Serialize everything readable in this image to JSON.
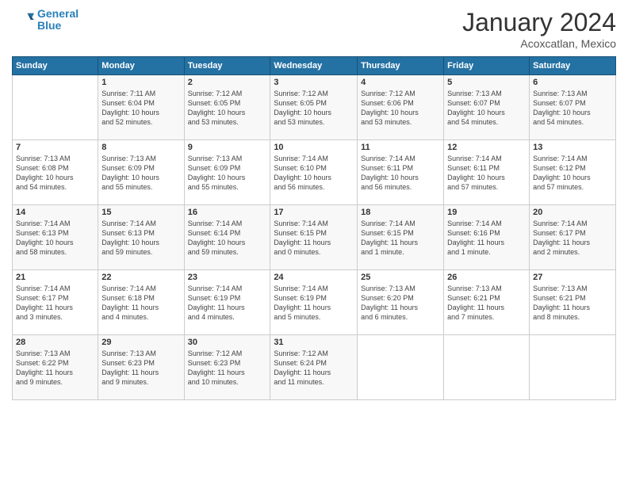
{
  "logo": {
    "line1": "General",
    "line2": "Blue"
  },
  "title": "January 2024",
  "location": "Acoxcatlan, Mexico",
  "days_header": [
    "Sunday",
    "Monday",
    "Tuesday",
    "Wednesday",
    "Thursday",
    "Friday",
    "Saturday"
  ],
  "weeks": [
    [
      {
        "day": "",
        "info": ""
      },
      {
        "day": "1",
        "info": "Sunrise: 7:11 AM\nSunset: 6:04 PM\nDaylight: 10 hours\nand 52 minutes."
      },
      {
        "day": "2",
        "info": "Sunrise: 7:12 AM\nSunset: 6:05 PM\nDaylight: 10 hours\nand 53 minutes."
      },
      {
        "day": "3",
        "info": "Sunrise: 7:12 AM\nSunset: 6:05 PM\nDaylight: 10 hours\nand 53 minutes."
      },
      {
        "day": "4",
        "info": "Sunrise: 7:12 AM\nSunset: 6:06 PM\nDaylight: 10 hours\nand 53 minutes."
      },
      {
        "day": "5",
        "info": "Sunrise: 7:13 AM\nSunset: 6:07 PM\nDaylight: 10 hours\nand 54 minutes."
      },
      {
        "day": "6",
        "info": "Sunrise: 7:13 AM\nSunset: 6:07 PM\nDaylight: 10 hours\nand 54 minutes."
      }
    ],
    [
      {
        "day": "7",
        "info": "Sunrise: 7:13 AM\nSunset: 6:08 PM\nDaylight: 10 hours\nand 54 minutes."
      },
      {
        "day": "8",
        "info": "Sunrise: 7:13 AM\nSunset: 6:09 PM\nDaylight: 10 hours\nand 55 minutes."
      },
      {
        "day": "9",
        "info": "Sunrise: 7:13 AM\nSunset: 6:09 PM\nDaylight: 10 hours\nand 55 minutes."
      },
      {
        "day": "10",
        "info": "Sunrise: 7:14 AM\nSunset: 6:10 PM\nDaylight: 10 hours\nand 56 minutes."
      },
      {
        "day": "11",
        "info": "Sunrise: 7:14 AM\nSunset: 6:11 PM\nDaylight: 10 hours\nand 56 minutes."
      },
      {
        "day": "12",
        "info": "Sunrise: 7:14 AM\nSunset: 6:11 PM\nDaylight: 10 hours\nand 57 minutes."
      },
      {
        "day": "13",
        "info": "Sunrise: 7:14 AM\nSunset: 6:12 PM\nDaylight: 10 hours\nand 57 minutes."
      }
    ],
    [
      {
        "day": "14",
        "info": "Sunrise: 7:14 AM\nSunset: 6:13 PM\nDaylight: 10 hours\nand 58 minutes."
      },
      {
        "day": "15",
        "info": "Sunrise: 7:14 AM\nSunset: 6:13 PM\nDaylight: 10 hours\nand 59 minutes."
      },
      {
        "day": "16",
        "info": "Sunrise: 7:14 AM\nSunset: 6:14 PM\nDaylight: 10 hours\nand 59 minutes."
      },
      {
        "day": "17",
        "info": "Sunrise: 7:14 AM\nSunset: 6:15 PM\nDaylight: 11 hours\nand 0 minutes."
      },
      {
        "day": "18",
        "info": "Sunrise: 7:14 AM\nSunset: 6:15 PM\nDaylight: 11 hours\nand 1 minute."
      },
      {
        "day": "19",
        "info": "Sunrise: 7:14 AM\nSunset: 6:16 PM\nDaylight: 11 hours\nand 1 minute."
      },
      {
        "day": "20",
        "info": "Sunrise: 7:14 AM\nSunset: 6:17 PM\nDaylight: 11 hours\nand 2 minutes."
      }
    ],
    [
      {
        "day": "21",
        "info": "Sunrise: 7:14 AM\nSunset: 6:17 PM\nDaylight: 11 hours\nand 3 minutes."
      },
      {
        "day": "22",
        "info": "Sunrise: 7:14 AM\nSunset: 6:18 PM\nDaylight: 11 hours\nand 4 minutes."
      },
      {
        "day": "23",
        "info": "Sunrise: 7:14 AM\nSunset: 6:19 PM\nDaylight: 11 hours\nand 4 minutes."
      },
      {
        "day": "24",
        "info": "Sunrise: 7:14 AM\nSunset: 6:19 PM\nDaylight: 11 hours\nand 5 minutes."
      },
      {
        "day": "25",
        "info": "Sunrise: 7:13 AM\nSunset: 6:20 PM\nDaylight: 11 hours\nand 6 minutes."
      },
      {
        "day": "26",
        "info": "Sunrise: 7:13 AM\nSunset: 6:21 PM\nDaylight: 11 hours\nand 7 minutes."
      },
      {
        "day": "27",
        "info": "Sunrise: 7:13 AM\nSunset: 6:21 PM\nDaylight: 11 hours\nand 8 minutes."
      }
    ],
    [
      {
        "day": "28",
        "info": "Sunrise: 7:13 AM\nSunset: 6:22 PM\nDaylight: 11 hours\nand 9 minutes."
      },
      {
        "day": "29",
        "info": "Sunrise: 7:13 AM\nSunset: 6:23 PM\nDaylight: 11 hours\nand 9 minutes."
      },
      {
        "day": "30",
        "info": "Sunrise: 7:12 AM\nSunset: 6:23 PM\nDaylight: 11 hours\nand 10 minutes."
      },
      {
        "day": "31",
        "info": "Sunrise: 7:12 AM\nSunset: 6:24 PM\nDaylight: 11 hours\nand 11 minutes."
      },
      {
        "day": "",
        "info": ""
      },
      {
        "day": "",
        "info": ""
      },
      {
        "day": "",
        "info": ""
      }
    ]
  ]
}
